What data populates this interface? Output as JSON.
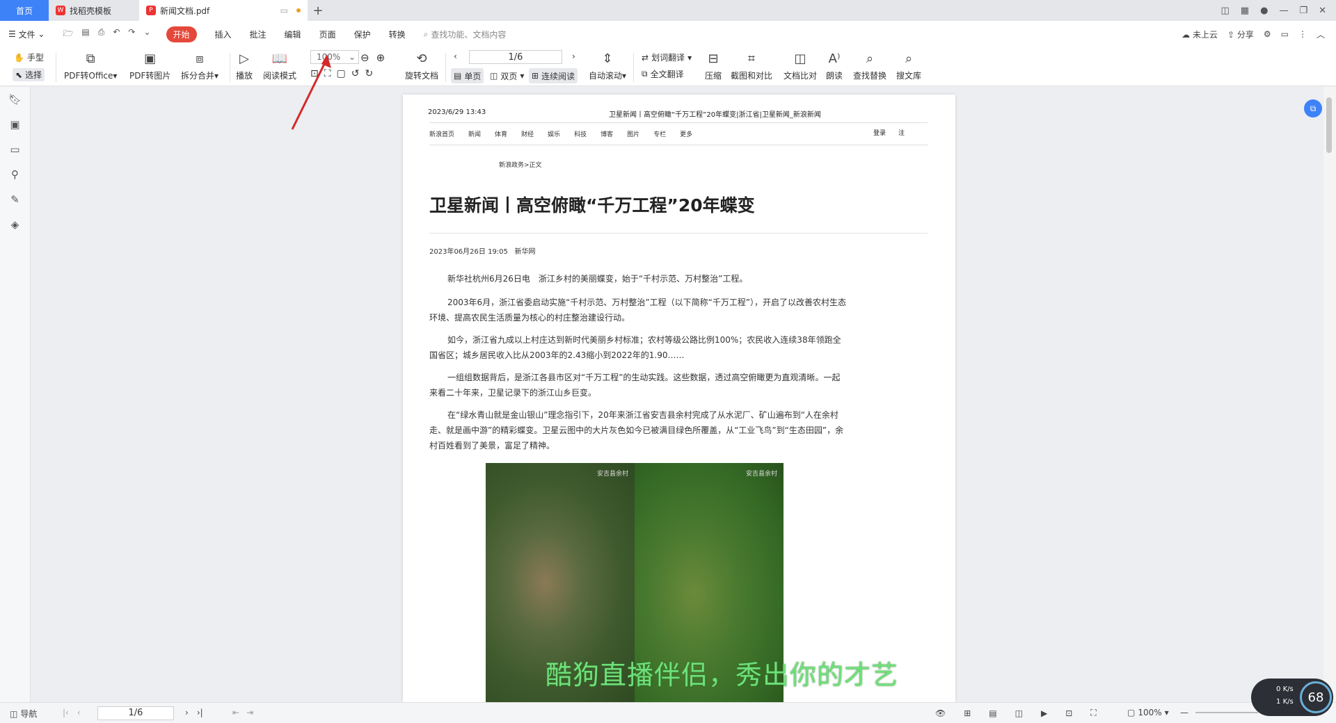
{
  "tabs": {
    "home": "首页",
    "template": "找稻壳模板",
    "doc": "新闻文档.pdf"
  },
  "menu": {
    "file": "文件",
    "items": [
      "开始",
      "插入",
      "批注",
      "编辑",
      "页面",
      "保护",
      "转换"
    ],
    "search_placeholder": "查找功能、文档内容",
    "cloud": "未上云",
    "share": "分享"
  },
  "ribbon": {
    "hand": "手型",
    "select": "选择",
    "pdf_office": "PDF转Office",
    "pdf_image": "PDF转图片",
    "split_merge": "拆分合并",
    "play": "播放",
    "read_mode": "阅读模式",
    "zoom": "100%",
    "rotate_doc": "旋转文档",
    "page_indicator": "1/6",
    "single": "单页",
    "double": "双页",
    "continuous": "连续阅读",
    "auto_scroll": "自动滚动",
    "word_translate": "划词翻译",
    "full_translate": "全文翻译",
    "compress": "压缩",
    "screenshot_compare": "截图和对比",
    "doc_compare": "文档比对",
    "read_aloud": "朗读",
    "find_replace": "查找替换",
    "search_lib": "搜文库"
  },
  "doc": {
    "header_date": "2023/6/29 13:43",
    "header_title": "卫星新闻丨高空俯瞰“千万工程”20年蝶变|浙江省|卫星新闻_新浪新闻",
    "nav": [
      "新浪首页",
      "新闻",
      "体育",
      "财经",
      "娱乐",
      "科技",
      "博客",
      "图片",
      "专栏",
      "更多"
    ],
    "login": "登录",
    "register": "注",
    "crumb": "新浪政务>正文",
    "title": "卫星新闻丨高空俯瞰“千万工程”20年蝶变",
    "meta_date": "2023年06月26日 19:05",
    "meta_source": "新华网",
    "p1": "新华社杭州6月26日电　浙江乡村的美丽蝶变，始于“千村示范、万村整治”工程。",
    "p2": "2003年6月，浙江省委启动实施“千村示范、万村整治”工程（以下简称“千万工程”），开启了以改善农村生态环境、提高农民生活质量为核心的村庄整治建设行动。",
    "p3": "如今，浙江省九成以上村庄达到新时代美丽乡村标准；农村等级公路比例100%；农民收入连续38年领跑全国省区；城乡居民收入比从2003年的2.43缩小到2022年的1.90……",
    "p4": "一组组数据背后，是浙江各县市区对“千万工程”的生动实践。这些数据，透过高空俯瞰更为直观清晰。一起来看二十年来，卫星记录下的浙江山乡巨变。",
    "p5": "在“绿水青山就是金山银山”理念指引下，20年来浙江省安吉县余村完成了从水泥厂、矿山遍布到“人在余村走、就是画中游”的精彩蝶变。卫星云图中的大片灰色如今已被满目绿色所覆盖，从“工业飞鸟”到“生态田园”，余村百姓看到了美景，富足了精神。",
    "photo_cap_left": "安吉县余村",
    "photo_cap_right": "安吉县余村",
    "overlay": "酷狗直播伴侣，秀出你的才艺"
  },
  "status": {
    "nav": "导航",
    "page": "1/6",
    "zoom": "100%",
    "net_up": "0",
    "net_down": "1",
    "net_unit": "K/s",
    "percent": "68"
  },
  "colors": {
    "accent": "#3e82f7",
    "active_tab": "#e5483a",
    "annotation_arrow": "#d42a2a"
  }
}
